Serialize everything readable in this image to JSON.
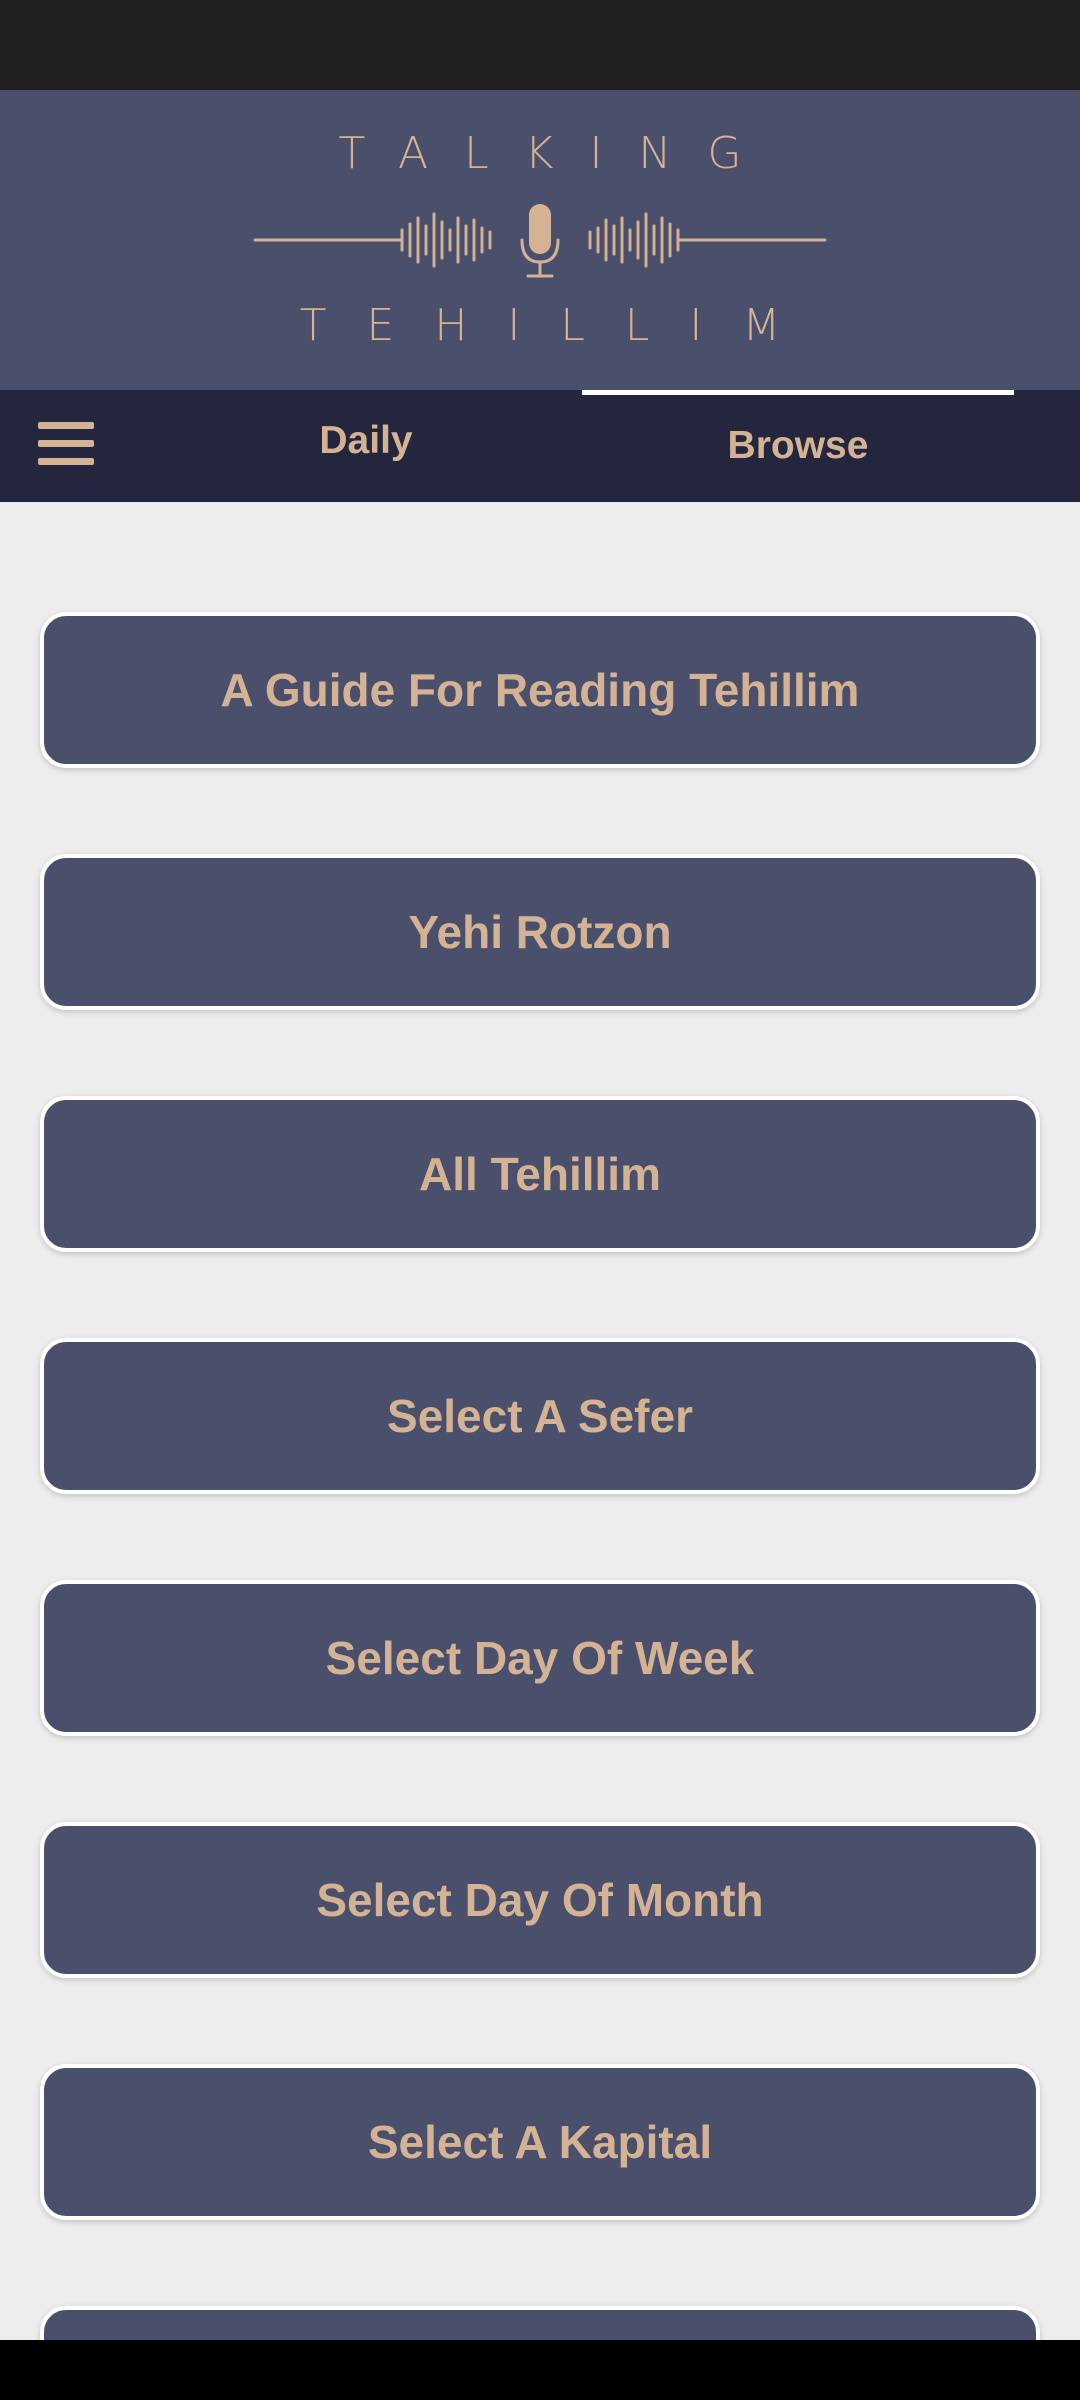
{
  "header": {
    "logo_top": "TALKING",
    "logo_bottom": "TEHILLIM",
    "logo_icon": "microphone-waveform-icon"
  },
  "tabs": {
    "menu_icon": "hamburger-menu-icon",
    "daily": "Daily",
    "browse": "Browse",
    "active": "Browse"
  },
  "menu": {
    "items": [
      "A Guide For Reading Tehillim",
      "Yehi Rotzon",
      "All Tehillim",
      "Select A Sefer",
      "Select Day Of Week",
      "Select Day Of Month",
      "Select A Kapital",
      ""
    ]
  },
  "colors": {
    "header_bg": "#4a4f6b",
    "tabbar_bg": "#23263c",
    "accent_gold": "#d4b294",
    "page_bg": "#ededed"
  }
}
